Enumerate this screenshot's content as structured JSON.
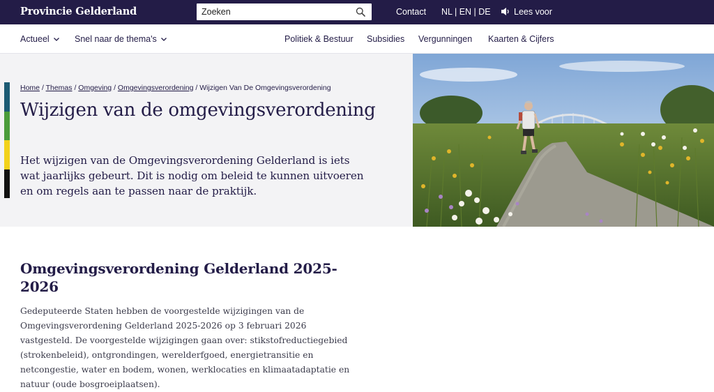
{
  "header": {
    "brand": "Provincie Gelderland",
    "search_placeholder": "Zoeken",
    "contact": "Contact",
    "languages": "NL | EN | DE",
    "read_aloud": "Lees voor"
  },
  "nav": {
    "left": [
      {
        "label": "Actueel"
      },
      {
        "label": "Snel naar de thema's"
      }
    ],
    "right": [
      {
        "label": "Politiek & Bestuur"
      },
      {
        "label": "Subsidies"
      },
      {
        "label": "Vergunningen"
      },
      {
        "label": "Kaarten & Cijfers"
      }
    ]
  },
  "breadcrumb": {
    "items": [
      "Home",
      "Themas",
      "Omgeving",
      "Omgevingsverordening"
    ],
    "current": "Wijzigen Van De Omgevingsverordening",
    "separator": "/"
  },
  "hero": {
    "title": "Wijzigen van de omgevingsverordening",
    "intro": "Het wijzigen van de Omgevingsverordening Gelderland is iets wat jaarlijks gebeurt. Dit is nodig om beleid te kunnen uitvoeren en om regels aan te passen naar de praktijk.",
    "stripe_colors": [
      "#1c5b74",
      "#4a9c3a",
      "#f2d21b",
      "#111111"
    ]
  },
  "content": {
    "section_title": "Omgevingsverordening Gelderland 2025-2026",
    "paragraph": "Gedeputeerde Staten hebben de voorgestelde wijzigingen van de Omgevingsverordening Gelderland 2025-2026 op 3 februari 2026 vastgesteld. De voorgestelde wijzigingen gaan over: stikstofreductiegebied (strokenbeleid), ontgrondingen, werelderfgoed, energietransitie en netcongestie, water en bodem, wonen, werklocaties en klimaatadaptatie en natuur (oude bosgroeiplaatsen)."
  },
  "colors": {
    "brand_dark": "#231c47",
    "hero_bg": "#f3f3f5"
  }
}
